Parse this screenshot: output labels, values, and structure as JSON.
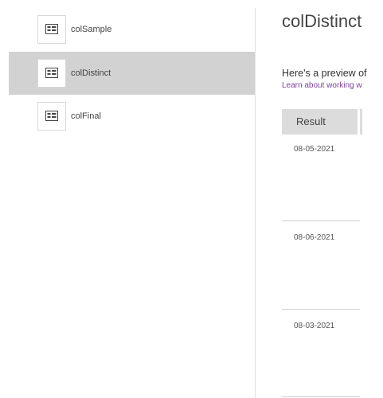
{
  "sidebar": {
    "items": [
      {
        "label": "colSample",
        "icon": "collection-icon",
        "selected": false
      },
      {
        "label": "colDistinct",
        "icon": "collection-icon",
        "selected": true
      },
      {
        "label": "colFinal",
        "icon": "collection-icon",
        "selected": false
      }
    ]
  },
  "main": {
    "title": "colDistinct",
    "preview_text": "Here's a preview of",
    "learn_link": "Learn about working w",
    "table": {
      "columns": [
        "Result"
      ],
      "rows": [
        "08-05-2021",
        "08-06-2021",
        "08-03-2021"
      ]
    }
  },
  "colors": {
    "selected_bg": "#d2d2d2",
    "header_bg": "#dcdcdc",
    "link": "#7a3ea0"
  }
}
